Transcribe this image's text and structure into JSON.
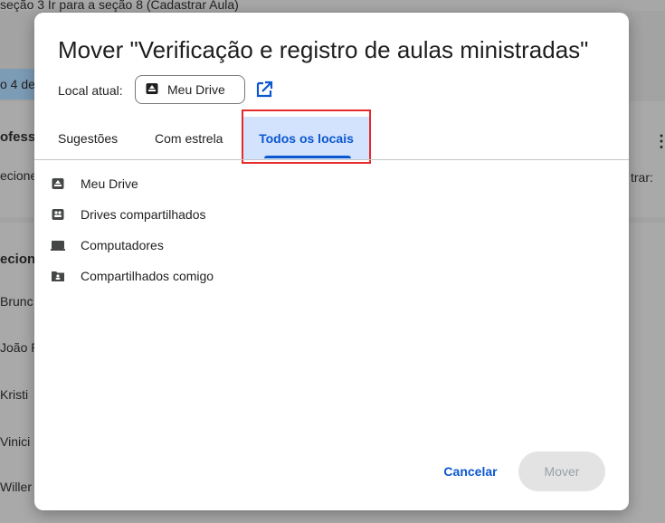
{
  "background": {
    "top_text": "seção 3   Ir para a seção 8 (Cadastrar Aula)",
    "side_fragments": [
      "o 4 de",
      "ofesso",
      "ecione",
      "ecion",
      "Brunc",
      "João F",
      "Kristi",
      "Vinici",
      "Willer"
    ],
    "right_fragment": "trar:",
    "more_label": "⋮"
  },
  "dialog": {
    "title": "Mover \"Verificação e registro de aulas ministradas\"",
    "location_label": "Local atual:",
    "location_chip": "Meu Drive",
    "tabs": [
      {
        "label": "Sugestões",
        "active": false
      },
      {
        "label": "Com estrela",
        "active": false
      },
      {
        "label": "Todos os locais",
        "active": true
      }
    ],
    "items": [
      {
        "label": "Meu Drive",
        "icon": "drive-icon"
      },
      {
        "label": "Drives compartilhados",
        "icon": "shared-drives-icon"
      },
      {
        "label": "Computadores",
        "icon": "computer-icon"
      },
      {
        "label": "Compartilhados comigo",
        "icon": "shared-folder-icon"
      }
    ],
    "cancel_label": "Cancelar",
    "move_label": "Mover"
  },
  "colors": {
    "accent": "#0b57d0",
    "tab_active_bg": "#d3e3fd",
    "highlight": "#e52b2b"
  }
}
